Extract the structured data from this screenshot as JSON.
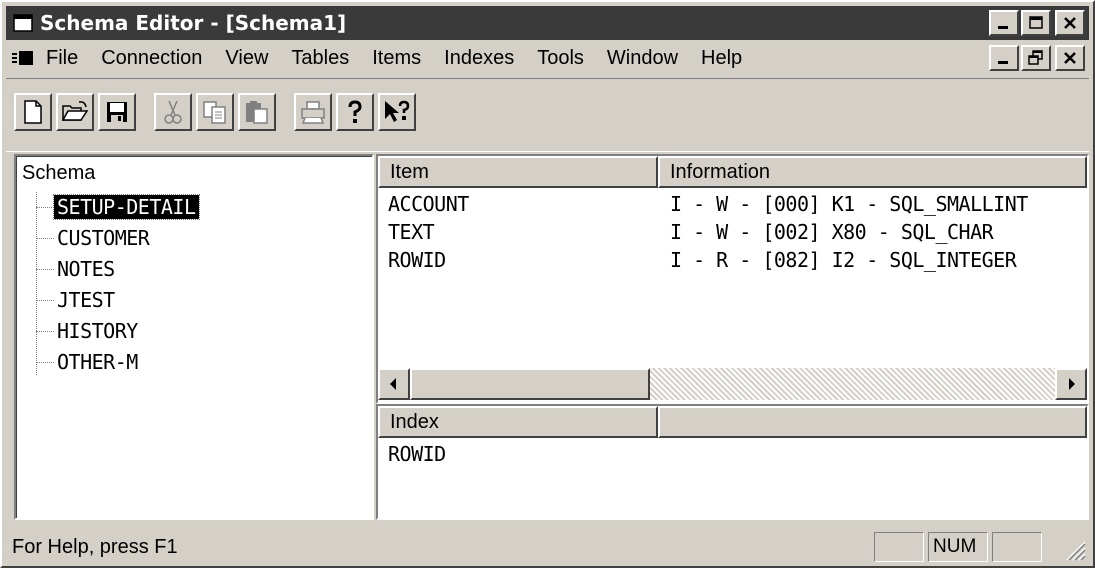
{
  "window": {
    "title": "Schema Editor - [Schema1]"
  },
  "menu": {
    "items": [
      {
        "label": "File",
        "name": "file"
      },
      {
        "label": "Connection",
        "name": "connection"
      },
      {
        "label": "View",
        "name": "view"
      },
      {
        "label": "Tables",
        "name": "tables"
      },
      {
        "label": "Items",
        "name": "items"
      },
      {
        "label": "Indexes",
        "name": "indexes"
      },
      {
        "label": "Tools",
        "name": "tools"
      },
      {
        "label": "Window",
        "name": "window"
      },
      {
        "label": "Help",
        "name": "help"
      }
    ]
  },
  "toolbar": {
    "buttons": [
      "new-file-icon",
      "open-folder-icon",
      "save-icon",
      "cut-icon",
      "copy-icon",
      "paste-icon",
      "print-icon",
      "help-icon",
      "context-help-icon"
    ]
  },
  "tree": {
    "root": "Schema",
    "nodes": [
      {
        "label": "SETUP-DETAIL",
        "selected": true
      },
      {
        "label": "CUSTOMER",
        "selected": false
      },
      {
        "label": "NOTES",
        "selected": false
      },
      {
        "label": "JTEST",
        "selected": false
      },
      {
        "label": "HISTORY",
        "selected": false
      },
      {
        "label": "OTHER-M",
        "selected": false
      }
    ]
  },
  "items_table": {
    "headers": [
      "Item",
      "Information"
    ],
    "rows": [
      [
        "ACCOUNT",
        "I - W - [000] K1 - SQL_SMALLINT"
      ],
      [
        "TEXT",
        "I - W - [002] X80 - SQL_CHAR"
      ],
      [
        "ROWID",
        "I - R - [082] I2 - SQL_INTEGER"
      ]
    ]
  },
  "index_table": {
    "headers": [
      "Index",
      ""
    ],
    "rows": [
      [
        "ROWID"
      ]
    ]
  },
  "status": {
    "text": "For Help, press F1",
    "panel1": "",
    "panel2": "NUM",
    "panel3": ""
  },
  "colors": {
    "title_bg": "#3a3a3a",
    "face": "#d4d0c8",
    "selection": "#000000"
  }
}
